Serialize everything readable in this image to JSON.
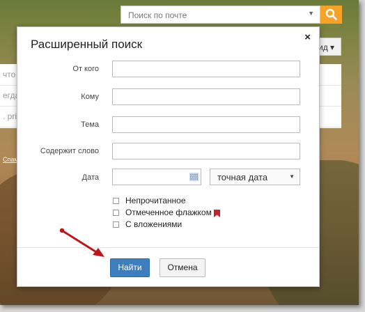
{
  "header": {
    "search_placeholder": "Поиск по почте",
    "view_button": "ид"
  },
  "background": {
    "rows": [
      "что",
      "егда",
      ". prin"
    ],
    "spam_link": "Спам"
  },
  "dialog": {
    "title": "Расширенный поиск",
    "close": "×",
    "fields": {
      "from_label": "От кого",
      "to_label": "Кому",
      "subject_label": "Тема",
      "contains_label": "Содержит слово",
      "date_label": "Дата"
    },
    "date_mode": "точная дата",
    "checkboxes": {
      "unread": "Непрочитанное",
      "flagged": "Отмеченное флажком",
      "attachments": "С вложениями"
    },
    "find_button": "Найти",
    "cancel_button": "Отмена"
  },
  "colors": {
    "accent_search": "#f6a228",
    "primary_button": "#3d7ebf",
    "flag": "#c0262d",
    "annotation_arrow": "#c0141b"
  }
}
